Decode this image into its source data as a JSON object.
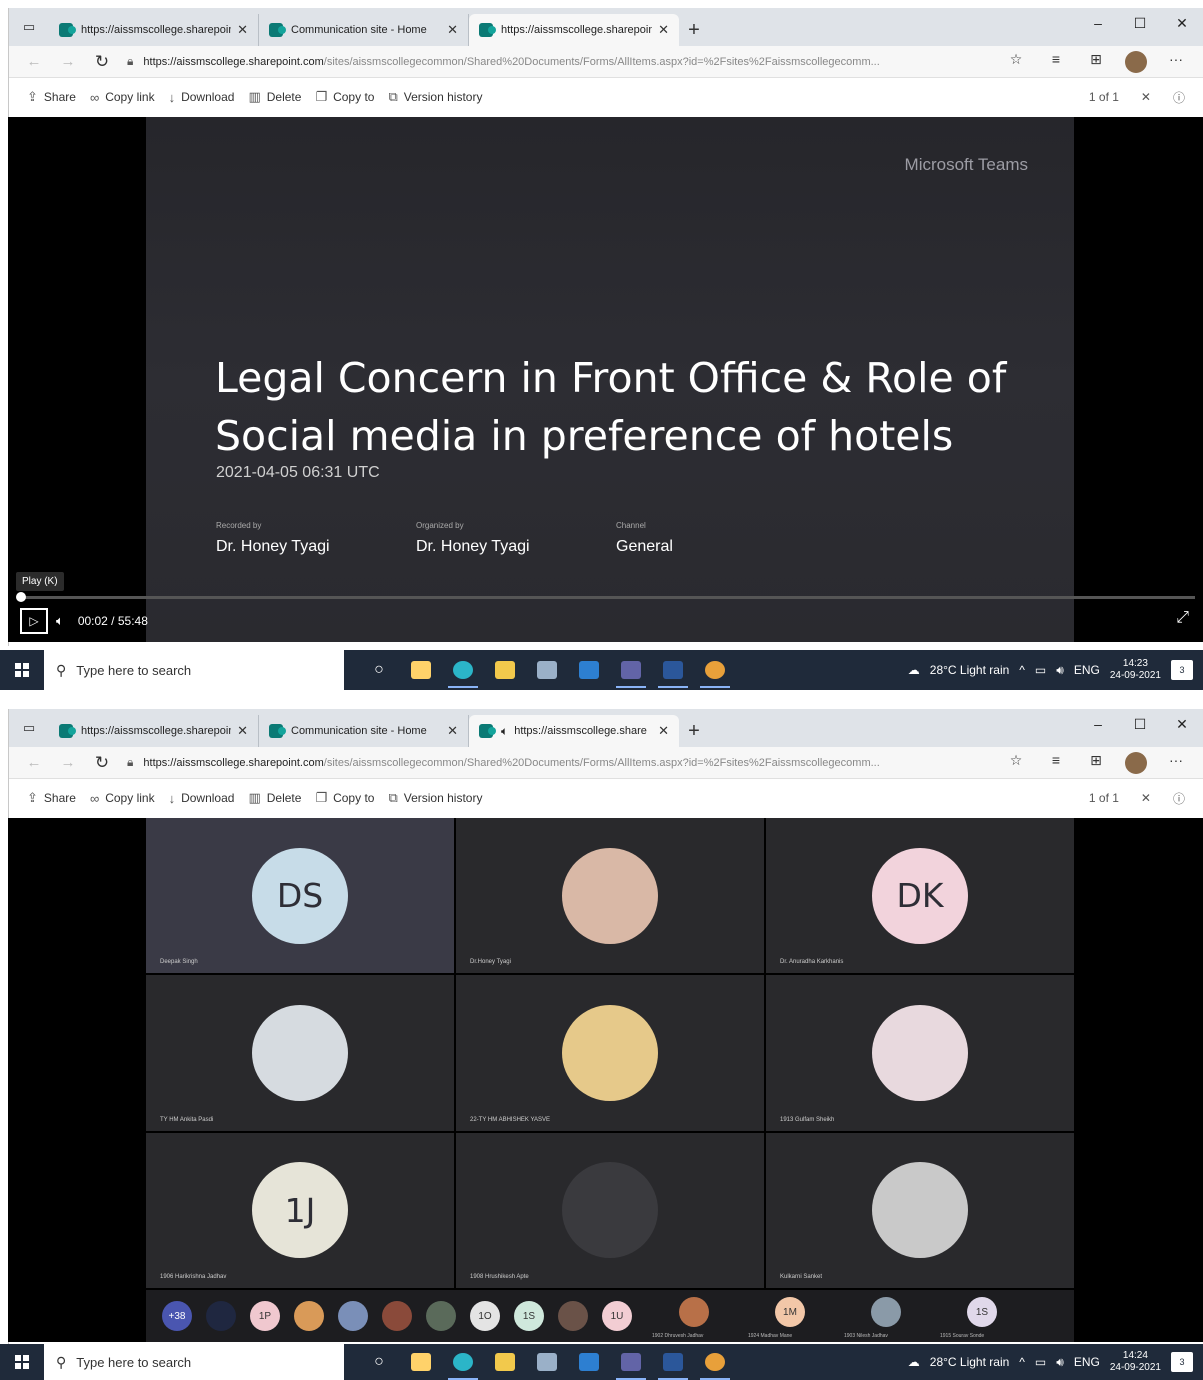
{
  "browser": {
    "tabs": [
      {
        "title": "https://aissmscollege.sharepoint",
        "active": false
      },
      {
        "title": "Communication site - Home",
        "active": false
      },
      {
        "title": "https://aissmscollege.sharepoint",
        "active": true
      }
    ],
    "tabs2_third": "https://aissmscollege.share",
    "url_host": "https://aissmscollege.sharepoint.com",
    "url_rest": "/sites/aissmscollegecommon/Shared%20Documents/Forms/AllItems.aspx?id=%2Fsites%2Faissmscollegecomm...",
    "more": "···"
  },
  "commands": {
    "share": "Share",
    "copy_link": "Copy link",
    "download": "Download",
    "delete": "Delete",
    "copy_to": "Copy to",
    "version_history": "Version history",
    "pager": "1 of 1"
  },
  "slide": {
    "brand": "Microsoft Teams",
    "title": "Legal Concern in Front Office & Role of Social media in preference of hotels",
    "date": "2021-04-05 06:31 UTC",
    "recorded_label": "Recorded by",
    "recorded_value": "Dr. Honey Tyagi",
    "organized_label": "Organized by",
    "organized_value": "Dr. Honey Tyagi",
    "channel_label": "Channel",
    "channel_value": "General"
  },
  "player": {
    "tooltip": "Play (K)",
    "time": "00:02 / 55:48",
    "progress": 0.0006
  },
  "gallery": {
    "tiles": [
      {
        "initials": "DS",
        "name": "Deepak Singh",
        "bg": "#c7dce8",
        "highlight": true
      },
      {
        "initials": "",
        "name": "Dr.Honey Tyagi",
        "bg": "#d9b8a6",
        "highlight": false
      },
      {
        "initials": "DK",
        "name": "Dr. Anuradha Karkhanis",
        "bg": "#f2d3dc",
        "highlight": false
      },
      {
        "initials": "",
        "name": "TY HM Ankita Pasdi",
        "bg": "#d6dbe0",
        "highlight": false
      },
      {
        "initials": "",
        "name": "22-TY HM ABHISHEK YASVE",
        "bg": "#e6c98a",
        "highlight": false
      },
      {
        "initials": "",
        "name": "1913 Gulfam Sheikh",
        "bg": "#e8d9de",
        "highlight": false
      },
      {
        "initials": "1J",
        "name": "1906 Harikrishna Jadhav",
        "bg": "#e6e4d8",
        "highlight": false
      },
      {
        "initials": "",
        "name": "1908 Hrushikesh Apte",
        "bg": "#3a3a3e",
        "highlight": false
      },
      {
        "initials": "",
        "name": "Kulkarni Sanket",
        "bg": "#c9c9c9",
        "highlight": false
      }
    ],
    "strip": [
      {
        "text": "+38",
        "bg": "#4a56b0"
      },
      {
        "text": "",
        "bg": "#1f2740"
      },
      {
        "text": "1P",
        "bg": "#f0c8cf"
      },
      {
        "text": "",
        "bg": "#d99a58"
      },
      {
        "text": "",
        "bg": "#7a8fb8"
      },
      {
        "text": "",
        "bg": "#8a4a3a"
      },
      {
        "text": "",
        "bg": "#5a6a5a"
      },
      {
        "text": "1O",
        "bg": "#e4e4e4"
      },
      {
        "text": "1S",
        "bg": "#cfe8dc"
      },
      {
        "text": "",
        "bg": "#6a5248"
      },
      {
        "text": "1U",
        "bg": "#f2cdd3"
      }
    ],
    "strip_named": [
      {
        "text": "",
        "name": "1902 Dhruvesh Jadhav",
        "bg": "#b87048"
      },
      {
        "text": "1M",
        "name": "1924 Madhav Mane",
        "bg": "#f2c7a8"
      },
      {
        "text": "",
        "name": "1903 Nilesh Jadhav",
        "bg": "#8a9aa8"
      },
      {
        "text": "1S",
        "name": "1915 Sourav Sonde",
        "bg": "#e0d8ea"
      }
    ]
  },
  "taskbar": {
    "search_placeholder": "Type here to search",
    "weather": "28°C  Light rain",
    "lang": "ENG",
    "time1": "14:23",
    "time2": "14:24",
    "date": "24-09-2021",
    "notif": "3"
  }
}
